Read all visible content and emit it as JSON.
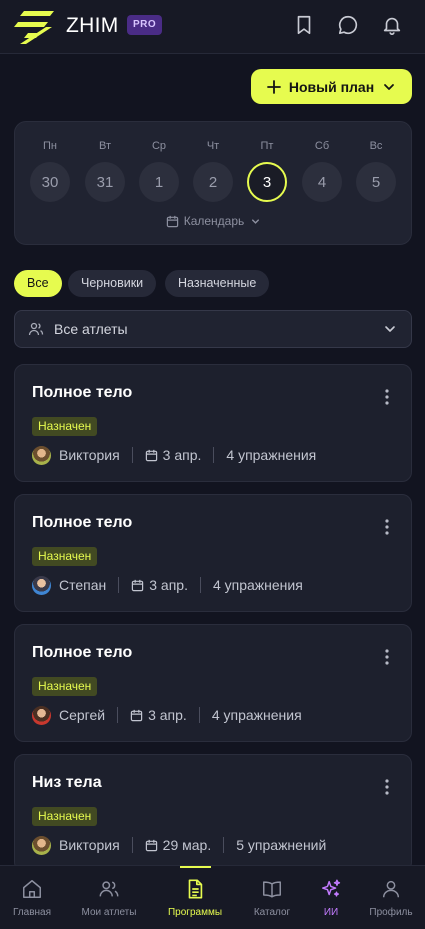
{
  "header": {
    "brand": "ZHIM",
    "badge": "PRO",
    "icons": [
      "bookmark-icon",
      "chat-icon",
      "bell-icon"
    ]
  },
  "new_plan_label": "Новый план",
  "week": {
    "days": [
      {
        "name": "Пн",
        "num": "30"
      },
      {
        "name": "Вт",
        "num": "31"
      },
      {
        "name": "Ср",
        "num": "1"
      },
      {
        "name": "Чт",
        "num": "2"
      },
      {
        "name": "Пт",
        "num": "3"
      },
      {
        "name": "Сб",
        "num": "4"
      },
      {
        "name": "Вс",
        "num": "5"
      }
    ],
    "selected_day": "3",
    "calendar_label": "Календарь"
  },
  "filters": {
    "chips": [
      "Все",
      "Черновики",
      "Назначенные"
    ],
    "active": "Все"
  },
  "athlete_select": {
    "value": "Все атлеты"
  },
  "plans": [
    {
      "title": "Полное тело",
      "status": "Назначен",
      "athlete": "Виктория",
      "date": "3 апр.",
      "exercises": "4 упражнения"
    },
    {
      "title": "Полное тело",
      "status": "Назначен",
      "athlete": "Степан",
      "date": "3 апр.",
      "exercises": "4 упражнения"
    },
    {
      "title": "Полное тело",
      "status": "Назначен",
      "athlete": "Сергей",
      "date": "3 апр.",
      "exercises": "4 упражнения"
    },
    {
      "title": "Низ тела",
      "status": "Назначен",
      "athlete": "Виктория",
      "date": "29 мар.",
      "exercises": "5 упражнений"
    }
  ],
  "bottom_nav": {
    "items": [
      {
        "label": "Главная",
        "icon": "home-icon"
      },
      {
        "label": "Мои атлеты",
        "icon": "users-icon"
      },
      {
        "label": "Программы",
        "icon": "document-icon"
      },
      {
        "label": "Каталог",
        "icon": "book-icon"
      },
      {
        "label": "ИИ",
        "icon": "sparkles-icon"
      },
      {
        "label": "Профиль",
        "icon": "user-icon"
      }
    ],
    "active": "Программы"
  },
  "colors": {
    "accent": "#e6fb4f",
    "background": "#121420",
    "card": "#1d202d",
    "ai": "#c37bff",
    "badge_bg": "#424a22"
  }
}
